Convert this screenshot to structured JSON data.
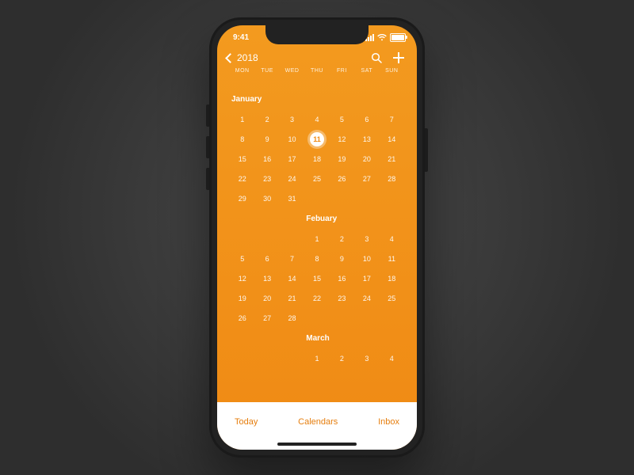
{
  "status": {
    "time": "9:41"
  },
  "header": {
    "year": "2018"
  },
  "weekdays": [
    "MON",
    "TUE",
    "WED",
    "THU",
    "FRI",
    "SAT",
    "SUN"
  ],
  "months": [
    {
      "name": "January",
      "offset": 0,
      "days": 31,
      "todayIndex": 11
    },
    {
      "name": "Febuary",
      "offset": 3,
      "days": 28
    },
    {
      "name": "March",
      "offset": 3,
      "days": 4
    }
  ],
  "tabbar": {
    "today": "Today",
    "calendars": "Calendars",
    "inbox": "Inbox"
  },
  "colors": {
    "accent": "#f08a14"
  }
}
